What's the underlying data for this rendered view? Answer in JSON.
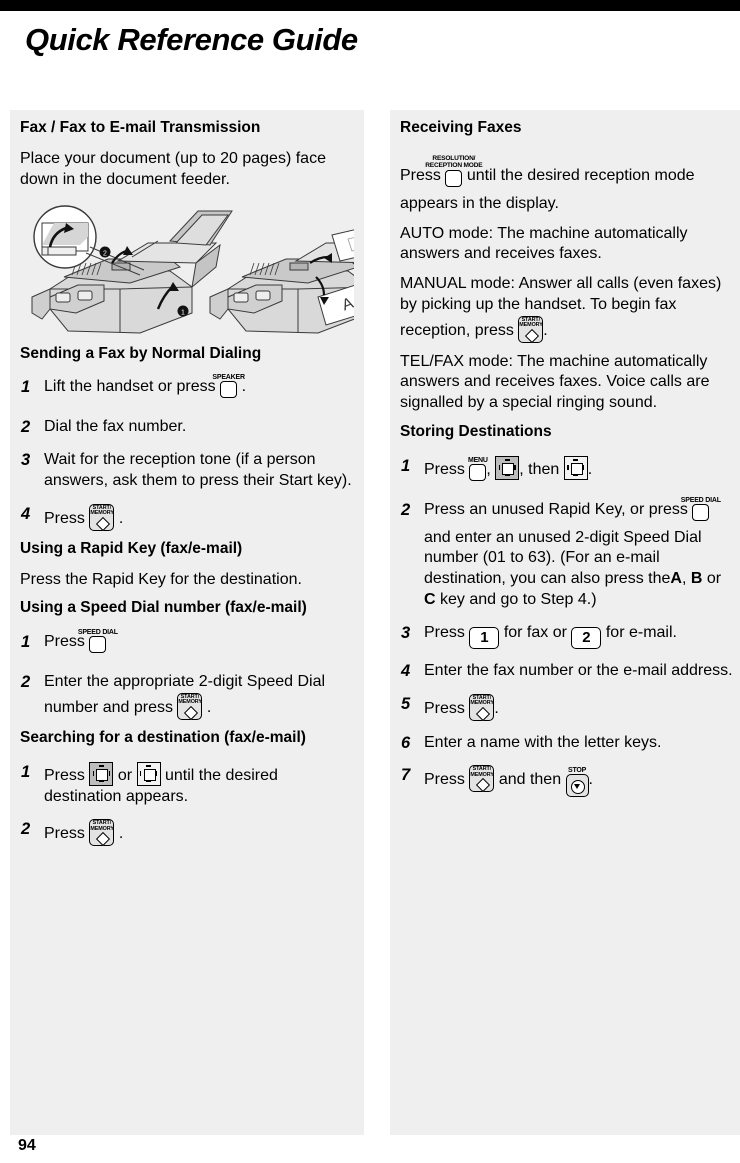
{
  "page": {
    "title": "Quick Reference Guide",
    "page_number": "94"
  },
  "keys": {
    "speaker": "SPEAKER",
    "start_memory_line1": "START/",
    "start_memory_line2": "MEMORY",
    "speed_dial": "SPEED DIAL",
    "menu": "MENU",
    "stop": "STOP",
    "resolution_line1": "RESOLUTION/",
    "resolution_line2": "RECEPTION MODE",
    "num_one": "1",
    "num_two": "2"
  },
  "left_column": {
    "section1_heading": "Fax / Fax to E-mail Transmission",
    "section1_text": "Place your document (up to 20 pages) face down in the document feeder.",
    "figure_caption_marks": [
      "1",
      "2"
    ],
    "section2_heading": "Sending a Fax by Normal Dialing",
    "section2_steps": [
      {
        "num": "1",
        "before": "Lift the handset or press",
        "after": "."
      },
      {
        "num": "2",
        "before": "Dial the fax number.",
        "after": ""
      },
      {
        "num": "3",
        "before": "Wait for the reception tone (if a person answers, ask them to press their Start key).",
        "after": ""
      },
      {
        "num": "4",
        "before": "Press",
        "after": "."
      }
    ],
    "section3_heading": "Using a Rapid Key (fax/e-mail)",
    "section3_text": "Press the Rapid Key for the destination.",
    "section4_heading": "Using a Speed Dial number (fax/e-mail)",
    "section4_steps": [
      {
        "num": "1",
        "before": "Press",
        "after": ""
      },
      {
        "num": "2",
        "before": "Enter the appropriate 2-digit Speed Dial number and press",
        "after": "."
      }
    ],
    "section5_heading": "Searching for a destination (fax/e-mail)",
    "section5_steps": [
      {
        "num": "1",
        "before": "Press",
        "mid": "or",
        "after": "until the desired destination appears."
      },
      {
        "num": "2",
        "before": "Press",
        "after": "."
      }
    ]
  },
  "right_column": {
    "section1_heading": "Receiving Faxes",
    "intro_before": "Press",
    "intro_after": "until the desired reception mode appears in the display.",
    "auto_mode": "AUTO mode: The machine automatically answers and receives faxes.",
    "manual_mode_before": "MANUAL mode: Answer all calls (even faxes) by picking up the handset. To begin fax reception, press",
    "manual_mode_after": ".",
    "telfax_mode": "TEL/FAX mode: The machine automatically answers and receives faxes. Voice calls are signalled by a special ringing sound.",
    "section2_heading": "Storing Destinations",
    "steps": [
      {
        "num": "1",
        "t1": "Press",
        "t2": ",",
        "t3": ", then",
        "t4": "."
      },
      {
        "num": "2",
        "t1": "Press an unused Rapid Key, or press",
        "t2": "and enter an unused 2-digit Speed Dial number (01 to 63). (For an e-mail destination, you can also press the",
        "k_a": "A",
        "sep1": ",",
        "k_b": "B",
        "sep2": "or",
        "k_c": "C",
        "t3": "key and go to Step 4.)"
      },
      {
        "num": "3",
        "t1": "Press",
        "t2": "for fax or",
        "t3": "for e-mail."
      },
      {
        "num": "4",
        "t1": "Enter the fax number or the e-mail address."
      },
      {
        "num": "5",
        "t1": "Press",
        "t2": "."
      },
      {
        "num": "6",
        "t1": "Enter a name with the letter keys."
      },
      {
        "num": "7",
        "t1": "Press",
        "t2": "and then",
        "t3": "."
      }
    ]
  },
  "colors": {
    "panel_bg": "#efefef",
    "page_bg": "#ffffff",
    "rule": "#000000"
  }
}
